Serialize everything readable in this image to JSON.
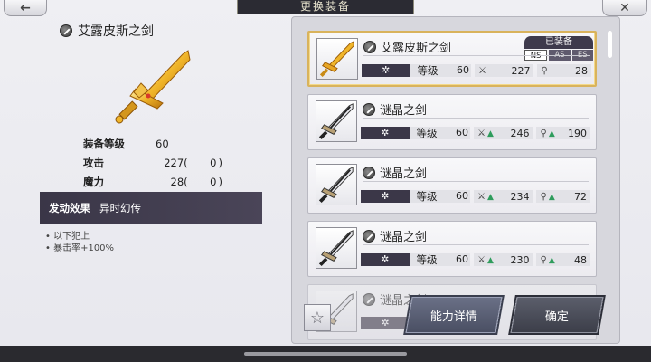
{
  "header": {
    "back_label": "←",
    "title": "更换装备",
    "close_label": "✕"
  },
  "detail": {
    "name": "艾露皮斯之剑",
    "stats": [
      {
        "label": "装备等级",
        "value": "60",
        "bonus": ""
      },
      {
        "label": "攻击",
        "value": "227",
        "bonus": "0"
      },
      {
        "label": "魔力",
        "value": "28",
        "bonus": "0"
      }
    ],
    "effect_key": "发动效果",
    "effect_name": "异时幻传",
    "effect_lines": [
      "• 以下犯上",
      "• 暴击率+100%"
    ]
  },
  "list": {
    "items": [
      {
        "name": "艾露皮斯之剑",
        "stars": "✲",
        "level_label": "等级",
        "level": "60",
        "atk": "227",
        "mag": "28",
        "atk_up": false,
        "mag_up": false,
        "equipped": true,
        "selected": true,
        "sword": "gold"
      },
      {
        "name": "谜晶之剑",
        "stars": "✲",
        "level_label": "等级",
        "level": "60",
        "atk": "246",
        "mag": "190",
        "atk_up": true,
        "mag_up": true,
        "equipped": false,
        "selected": false,
        "sword": "dark"
      },
      {
        "name": "谜晶之剑",
        "stars": "✲",
        "level_label": "等级",
        "level": "60",
        "atk": "234",
        "mag": "72",
        "atk_up": true,
        "mag_up": true,
        "equipped": false,
        "selected": false,
        "sword": "dark"
      },
      {
        "name": "谜晶之剑",
        "stars": "✲",
        "level_label": "等级",
        "level": "60",
        "atk": "230",
        "mag": "48",
        "atk_up": true,
        "mag_up": true,
        "equipped": false,
        "selected": false,
        "sword": "dark"
      }
    ],
    "partial_item": {
      "name": "谜晶之剑",
      "stars": "✲"
    },
    "equipped_label": "已装备",
    "equipped_tags": [
      "NS",
      "AS",
      "ES"
    ]
  },
  "buttons": {
    "favorite_icon": "star-icon",
    "detail_label": "能力详情",
    "confirm_label": "确定"
  },
  "colors": {
    "accent_gold": "#d9b35c",
    "panel_dark": "#3b3748",
    "up_green": "#2e9c5c"
  }
}
